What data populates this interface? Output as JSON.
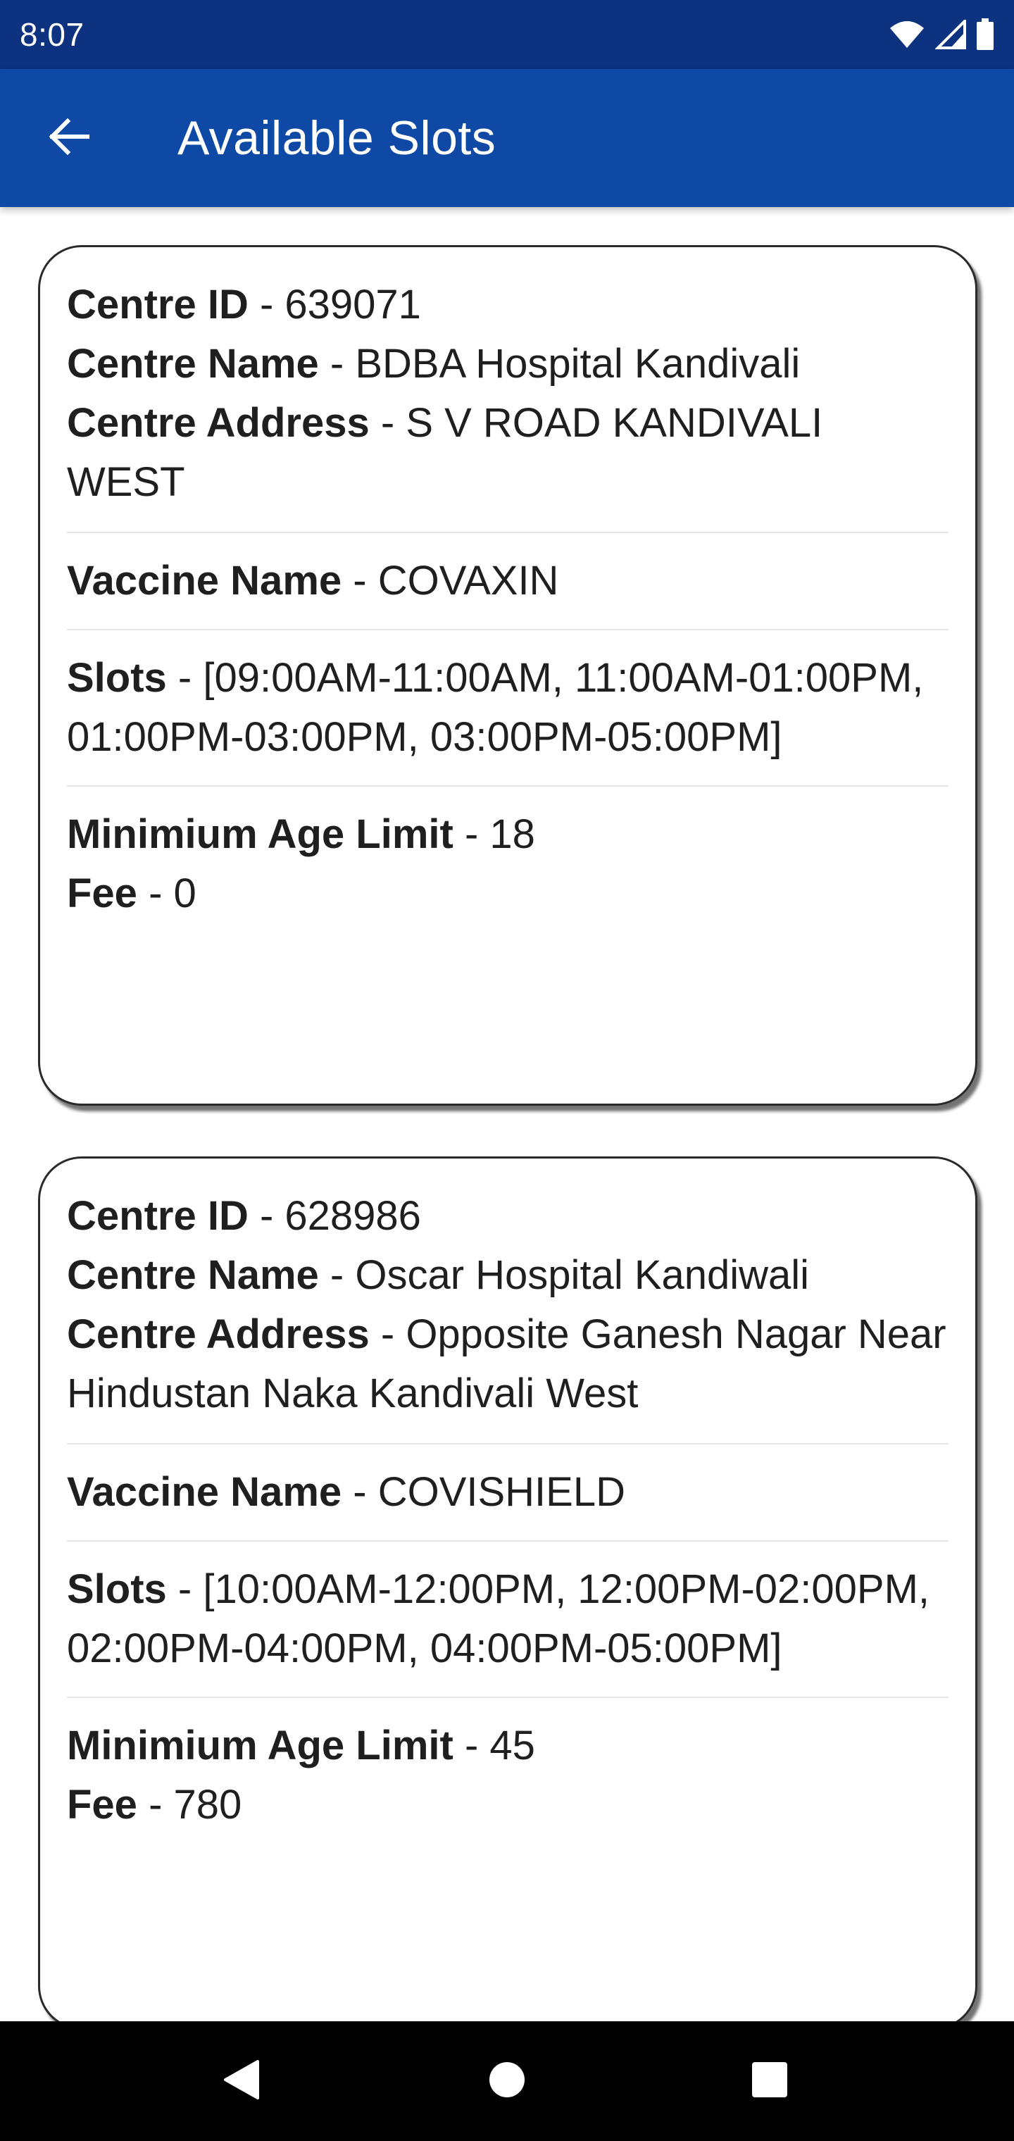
{
  "status_bar": {
    "time": "8:07",
    "icons": [
      "wifi-icon",
      "cell-signal-icon",
      "battery-icon"
    ]
  },
  "app_bar": {
    "back_icon": "arrow-left-icon",
    "title": "Available Slots"
  },
  "colors": {
    "status_bar_bg": "#0d3380",
    "app_bar_bg": "#0e49a6",
    "card_border": "#2a2a2a",
    "divider": "#e6e6e6",
    "nav_bar_bg": "#000000"
  },
  "centres": [
    {
      "id_label": "Centre ID",
      "id": "639071",
      "name_label": "Centre Name",
      "name": "BDBA Hospital Kandivali",
      "address_label": "Centre Address",
      "address": "S V ROAD KANDIVALI WEST",
      "vaccine_label": "Vaccine Name",
      "vaccine": "COVAXIN",
      "slots_label": "Slots",
      "slots": "[09:00AM-11:00AM, 11:00AM-01:00PM, 01:00PM-03:00PM, 03:00PM-05:00PM]",
      "age_label": "Minimium Age Limit",
      "age": "18",
      "fee_label": "Fee",
      "fee": "0"
    },
    {
      "id_label": "Centre ID",
      "id": "628986",
      "name_label": "Centre Name",
      "name": "Oscar Hospital Kandiwali",
      "address_label": "Centre Address",
      "address": "Opposite Ganesh Nagar Near Hindustan Naka Kandivali West",
      "vaccine_label": "Vaccine Name",
      "vaccine": "COVISHIELD",
      "slots_label": "Slots",
      "slots": "[10:00AM-12:00PM, 12:00PM-02:00PM, 02:00PM-04:00PM, 04:00PM-05:00PM]",
      "age_label": "Minimium Age Limit",
      "age": "45",
      "fee_label": "Fee",
      "fee": "780"
    }
  ],
  "separator": " - ",
  "nav_bar": {
    "back_icon": "nav-back-triangle-icon",
    "home_icon": "nav-home-circle-icon",
    "recents_icon": "nav-recents-square-icon"
  }
}
